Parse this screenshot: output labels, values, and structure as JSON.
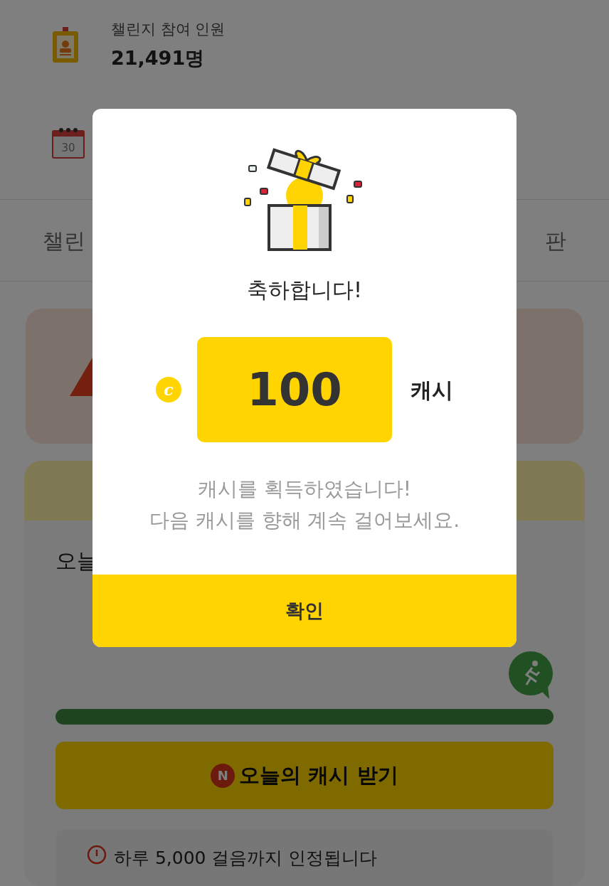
{
  "stats": [
    {
      "kind": "badge",
      "label": "챌린지 참여 인원",
      "value": "21,491명"
    },
    {
      "kind": "calendar",
      "calendar_day": "30"
    }
  ],
  "tabs": [
    "챌린",
    "판"
  ],
  "today_label": "오늘",
  "progress": {
    "level": 1
  },
  "cta": {
    "badge": "N",
    "label": "오늘의 캐시 받기"
  },
  "notice": "하루 5,000 걸음까지 인정됩니다",
  "modal": {
    "title": "축하합니다!",
    "coin": "c",
    "amount": "100",
    "unit": "캐시",
    "message": [
      "캐시를 획득하였습니다!",
      "다음 캐시를 향해 계속 걸어보세요."
    ],
    "confirm": "확인"
  }
}
